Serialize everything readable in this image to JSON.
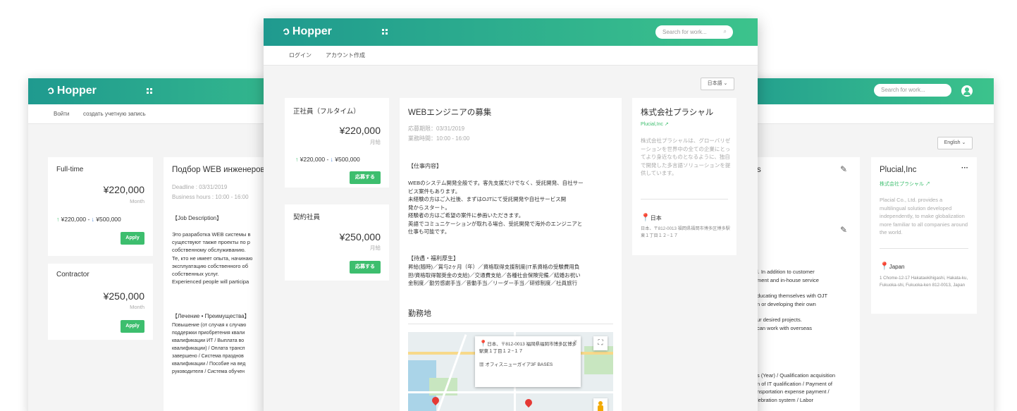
{
  "app": {
    "brand": "Hopper"
  },
  "left": {
    "nav": {
      "login": "Войти",
      "signup": "создать учетную запись"
    },
    "cards": [
      {
        "type": "Full-time",
        "salary": "¥220,000",
        "period": "Month",
        "range_low": "¥220,000",
        "range_sep": "-",
        "range_high": "¥500,000",
        "apply": "Apply"
      },
      {
        "type": "Contractor",
        "salary": "¥250,000",
        "period": "Month",
        "apply": "Apply"
      }
    ],
    "job": {
      "title": "Подбор WEB инженеров",
      "deadline": "Deadline : 03/31/2019",
      "hours": "Business hours : 10:00 - 16:00",
      "desc_heading": "【Job Description】",
      "desc_lines": [
        "Это разработка WEB системы в",
        "существуют также проекты по р",
        "собственному обслуживанию.",
        "Те, кто не имеет опыта, начинаю",
        "эксплуатацию собственного об",
        "собственных услуг.",
        "Experienced people will participa"
      ],
      "benefits_heading": "【Лечение • Преимущества】",
      "benefits_lines": [
        "Повышение (от случая к случаю",
        "поддержки приобретения квали",
        "квалификации ИТ / Выплата во",
        "квалификации) / Оплата трансп",
        "завершено / Система празднов",
        "квалификации / Пособие на вед",
        "руководителя / Система обучен"
      ]
    }
  },
  "center": {
    "search_placeholder": "Search for work...",
    "nav": {
      "login": "ログイン",
      "signup": "アカウント作成"
    },
    "lang": "日本語",
    "cards": [
      {
        "type": "正社員（フルタイム）",
        "salary": "¥220,000",
        "period": "月給",
        "range_low": "¥220,000",
        "range_sep": "-",
        "range_high": "¥500,000",
        "apply": "応募する"
      },
      {
        "type": "契約社員",
        "salary": "¥250,000",
        "period": "月給",
        "apply": "応募する"
      }
    ],
    "job": {
      "title": "WEBエンジニアの募集",
      "deadline": "応募期限：03/31/2019",
      "hours": "業務時間：10:00 - 16:00",
      "desc_heading": "【仕事内容】",
      "desc_lines": [
        "WEBのシステム開発全般です。客先支援だけでなく、受託開発、自社サー",
        "ビス案件もあります。",
        "未経験の方はご入社後、まずはOJTにて受託開発や自社サービス開",
        "発からスタート。",
        "経験者の方はご希望の案件に参画いただきます。",
        "英語でコミュニケーションが取れる場合、受託開発で海外のエンジニアと",
        "仕事も可能です。"
      ],
      "benefits_heading": "【待遇・福利厚生】",
      "benefits_lines": [
        "昇給(随時)／賞与2ヶ月（年）／資格取得支援制度(IT系資格の受験費用負",
        "担/資格取得報奨金の支給)／交通費支給／各種社会保険完備／結婚お祝い",
        "金制度／勤労感謝手当／昔動手当／リーダー手当／研修制度／社員旅行"
      ],
      "location_heading": "勤務地",
      "map_popup_address": "日本、〒812-0013 福岡県福岡市博多区博多駅東１丁目１２−１７",
      "map_popup_building": "オフィスニューガイア3F BASES"
    },
    "company": {
      "name": "株式会社プラシャル",
      "link": "Plucial,Inc",
      "desc": "株式会社プラシャルは、グローバリゼーションを世界中の全ての企業にとってより身近なものとなるように、独自で開発した多言語ソリューションを提供しています。",
      "country": "日本",
      "address": "日本、〒812-0013 福岡県福岡市博多区博多駅東１丁目１２−１７"
    }
  },
  "right": {
    "search_placeholder": "Search for work...",
    "lang": "English",
    "job_title_fragment": "s",
    "desc_lines": [
      "l. In addition to customer",
      "ment and in-house service",
      "ducating themselves with OJT",
      "n or developing their own",
      "ur desired projects.",
      "can work with overseas"
    ],
    "benefits_lines": [
      "s (Year) / Qualification acquisition",
      "n of IT qualification / Payment of",
      "nsportation expense payment /",
      "lebration system / Labor"
    ],
    "company": {
      "name": "Plucial,Inc",
      "link": "株式会社プラシャル",
      "desc": "Placial Co., Ltd. provides a multilingual solution developed independently, to make globalization more familiar to all companies around the world.",
      "country": "Japan",
      "address": "1 Chome-12-17 Hakataekihigashi, Hakata-ku, Fukuoka-shi, Fukuoka-ken 812-0013, Japan",
      "more": "···"
    }
  },
  "colors": {
    "brand_start": "#1f9a8f",
    "brand_end": "#3cc38c",
    "apply": "#3dbe6e",
    "up": "#3dbe6e",
    "down": "#3a7bd5"
  }
}
